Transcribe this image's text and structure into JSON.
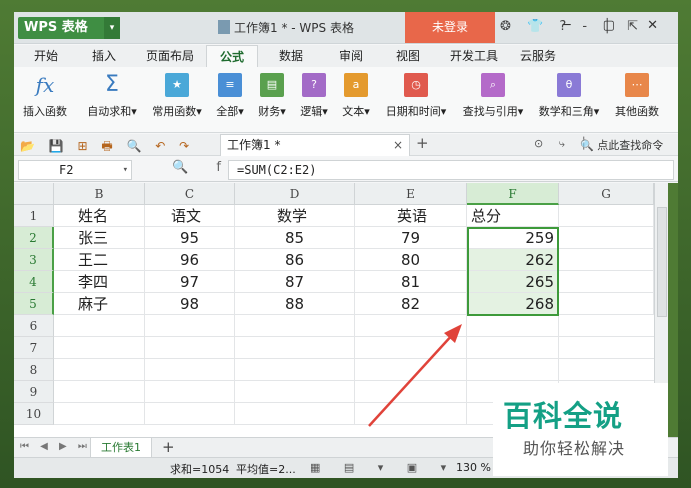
{
  "titlebar": {
    "app_name": "WPS 表格",
    "app_arrow": "▾",
    "doc_title": "工作簿1 * - WPS 表格",
    "login": "未登录",
    "icons": "❂ 👕 ? - │ ⇱",
    "window_controls": "─ ▢ ✕"
  },
  "tabs": [
    "开始",
    "插入",
    "页面布局",
    "公式",
    "数据",
    "审阅",
    "视图",
    "开发工具",
    "云服务"
  ],
  "active_tab": "公式",
  "ribbon": [
    {
      "label": "插入函数",
      "icon": "fx-icon",
      "color": "#3a7bbf"
    },
    {
      "label": "自动求和▾",
      "icon": "sigma-icon",
      "color": "#3a7bbf"
    },
    {
      "label": "常用函数▾",
      "icon": "star-icon",
      "color": "#4aa8d8"
    },
    {
      "label": "全部▾",
      "icon": "list-icon",
      "color": "#4a8fd6"
    },
    {
      "label": "财务▾",
      "icon": "finance-icon",
      "color": "#5aa04e"
    },
    {
      "label": "逻辑▾",
      "icon": "logic-icon",
      "color": "#a36bc7"
    },
    {
      "label": "文本▾",
      "icon": "text-a-icon",
      "color": "#e49a2e"
    },
    {
      "label": "日期和时间▾",
      "icon": "clock-icon",
      "color": "#e05a4e"
    },
    {
      "label": "查找与引用▾",
      "icon": "lookup-icon",
      "color": "#b46ac9"
    },
    {
      "label": "数学和三角▾",
      "icon": "theta-icon",
      "color": "#8a7ad6"
    },
    {
      "label": "其他函数",
      "icon": "more-icon",
      "color": "#e8874a"
    }
  ],
  "docbar": {
    "quick_access": "📂 💾 ⊞ 🖶 🔍 ↶ ↷",
    "doc_tab": "工作簿1 *",
    "close": "×",
    "add": "+",
    "right_icons": "⊙ ⤷ │",
    "find": "🔍 点此查找命令"
  },
  "formula_bar": {
    "name_box": "F2",
    "dropdown": "▾",
    "fx_icons": "🔍 fx",
    "formula": "=SUM(C2:E2)"
  },
  "columns": [
    "B",
    "C",
    "D",
    "E",
    "F",
    "G"
  ],
  "selected_column": "F",
  "rows": [
    "1",
    "2",
    "3",
    "4",
    "5",
    "6",
    "7",
    "8",
    "9",
    "10"
  ],
  "selected_rows": [
    "2",
    "3",
    "4",
    "5"
  ],
  "header_row": [
    "姓名",
    "语文",
    "数学",
    "英语",
    "总分"
  ],
  "table": [
    {
      "name": "张三",
      "chinese": "95",
      "math": "85",
      "english": "79",
      "total": "259"
    },
    {
      "name": "王二",
      "chinese": "96",
      "math": "86",
      "english": "80",
      "total": "262"
    },
    {
      "name": "李四",
      "chinese": "97",
      "math": "87",
      "english": "81",
      "total": "265"
    },
    {
      "name": "麻子",
      "chinese": "98",
      "math": "88",
      "english": "82",
      "total": "268"
    }
  ],
  "sheet": {
    "nav": "⏮ ◀ ▶ ⏭",
    "tab": "工作表1",
    "add": "+"
  },
  "status": {
    "sum": "求和=1054",
    "avg": "平均值=2...",
    "view_icons": "▦ ▤ ▾ ▣ ▾",
    "zoom": "130 %"
  },
  "watermark": {
    "line1": "百科全说",
    "line2": "助你轻松解决"
  },
  "colors": {
    "accent": "#3d9a3a",
    "login": "#e8674a",
    "watermark": "#14a085",
    "arrow": "#e0433a"
  }
}
